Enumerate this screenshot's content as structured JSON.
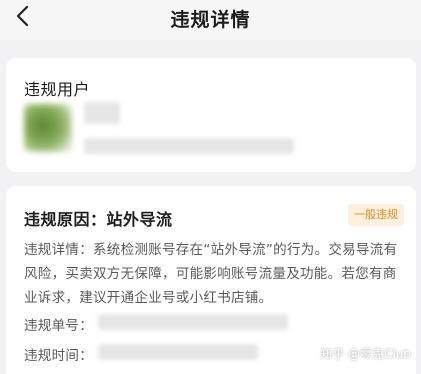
{
  "header": {
    "title": "违规详情",
    "back_icon": "chevron-left-icon"
  },
  "user_section": {
    "label": "违规用户"
  },
  "reason_section": {
    "title": "违规原因：站外导流",
    "badge": "一般违规",
    "detail": "违规详情：系统检测账号存在“站外导流”的行为。交易导流有风险，买卖双方无保障，可能影响账号流量及功能。若您有商业诉求，建议开通企业号或小红书店铺。",
    "order_label": "违规单号：",
    "time_label": "违规时间："
  },
  "watermark": "知乎 @零克Club",
  "colors": {
    "badge_bg": "#fdf0dc",
    "badge_text": "#e48a2a",
    "background": "#f2f2f4"
  }
}
